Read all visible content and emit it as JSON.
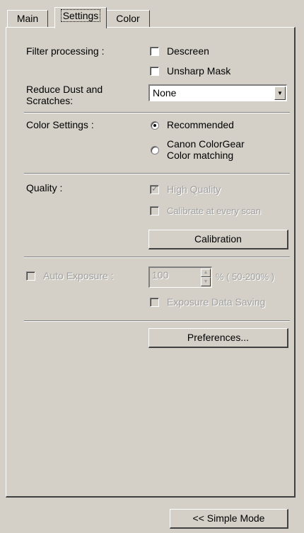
{
  "tabs": [
    {
      "label": "Main"
    },
    {
      "label": "Settings"
    },
    {
      "label": "Color"
    }
  ],
  "filter": {
    "label": "Filter processing :",
    "descreen": "Descreen",
    "unsharp": "Unsharp Mask"
  },
  "dust": {
    "label": "Reduce Dust and Scratches:",
    "value": "None"
  },
  "color_settings": {
    "label": "Color Settings :",
    "recommended": "Recommended",
    "colorgear": "Canon ColorGear Color matching",
    "selected": "Recommended"
  },
  "quality": {
    "label": "Quality :",
    "high_quality": "High Quality",
    "calibrate": "Calibrate at every scan",
    "calibration_button": "Calibration"
  },
  "exposure": {
    "auto_label": "Auto Exposure :",
    "value": "100",
    "range": "% ( 50-200% )",
    "data_saving": "Exposure Data Saving"
  },
  "preferences_button": "Preferences...",
  "simple_mode_button": "<< Simple Mode"
}
